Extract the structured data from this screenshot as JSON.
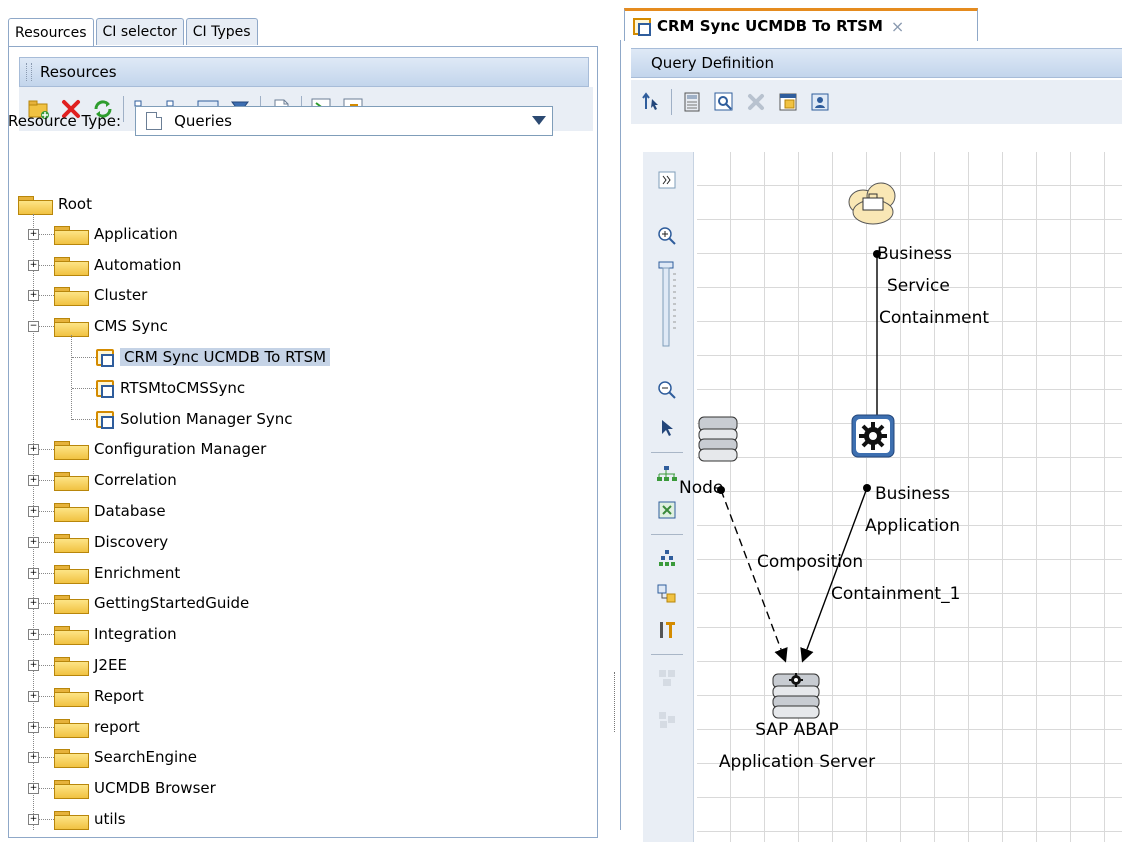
{
  "left_tabs": [
    "Resources",
    "CI selector",
    "CI Types"
  ],
  "resources_panel": {
    "title": "Resources",
    "resource_type_label": "Resource Type:",
    "resource_type_value": "Queries"
  },
  "toolbar_icons": [
    "new-folder-icon",
    "delete-icon",
    "refresh-icon",
    "expand-all-icon",
    "collapse-all-icon",
    "show-view-icon",
    "filter-icon",
    "properties-icon",
    "export-xml-icon",
    "import-xml-icon"
  ],
  "tree": {
    "root": "Root",
    "folders_before": [
      "Application",
      "Automation",
      "Cluster"
    ],
    "cms_sync": "CMS Sync",
    "cms_children": [
      "CRM Sync UCMDB To RTSM",
      "RTSMtoCMSSync",
      "Solution Manager Sync"
    ],
    "folders_after": [
      "Configuration Manager",
      "Correlation",
      "Database",
      "Discovery",
      "Enrichment",
      "GettingStartedGuide",
      "Integration",
      "J2EE",
      "Report",
      "report",
      "SearchEngine",
      "UCMDB Browser",
      "utils"
    ]
  },
  "editor": {
    "tab_title": "CRM Sync UCMDB To RTSM",
    "close": "×",
    "section_title": "Query Definition"
  },
  "diagram": {
    "business_service": [
      "Business",
      "Service"
    ],
    "containment": "Containment",
    "node": "Node",
    "business_application": [
      "Business",
      "Application"
    ],
    "composition": "Composition",
    "containment_1": "Containment_1",
    "sap_server": [
      "SAP ABAP",
      "Application Server"
    ]
  },
  "colors": {
    "folder": "#f1c242",
    "selection": "#c5d3e6",
    "header": "#c3d5ec",
    "tab_accent": "#e58b1e"
  }
}
